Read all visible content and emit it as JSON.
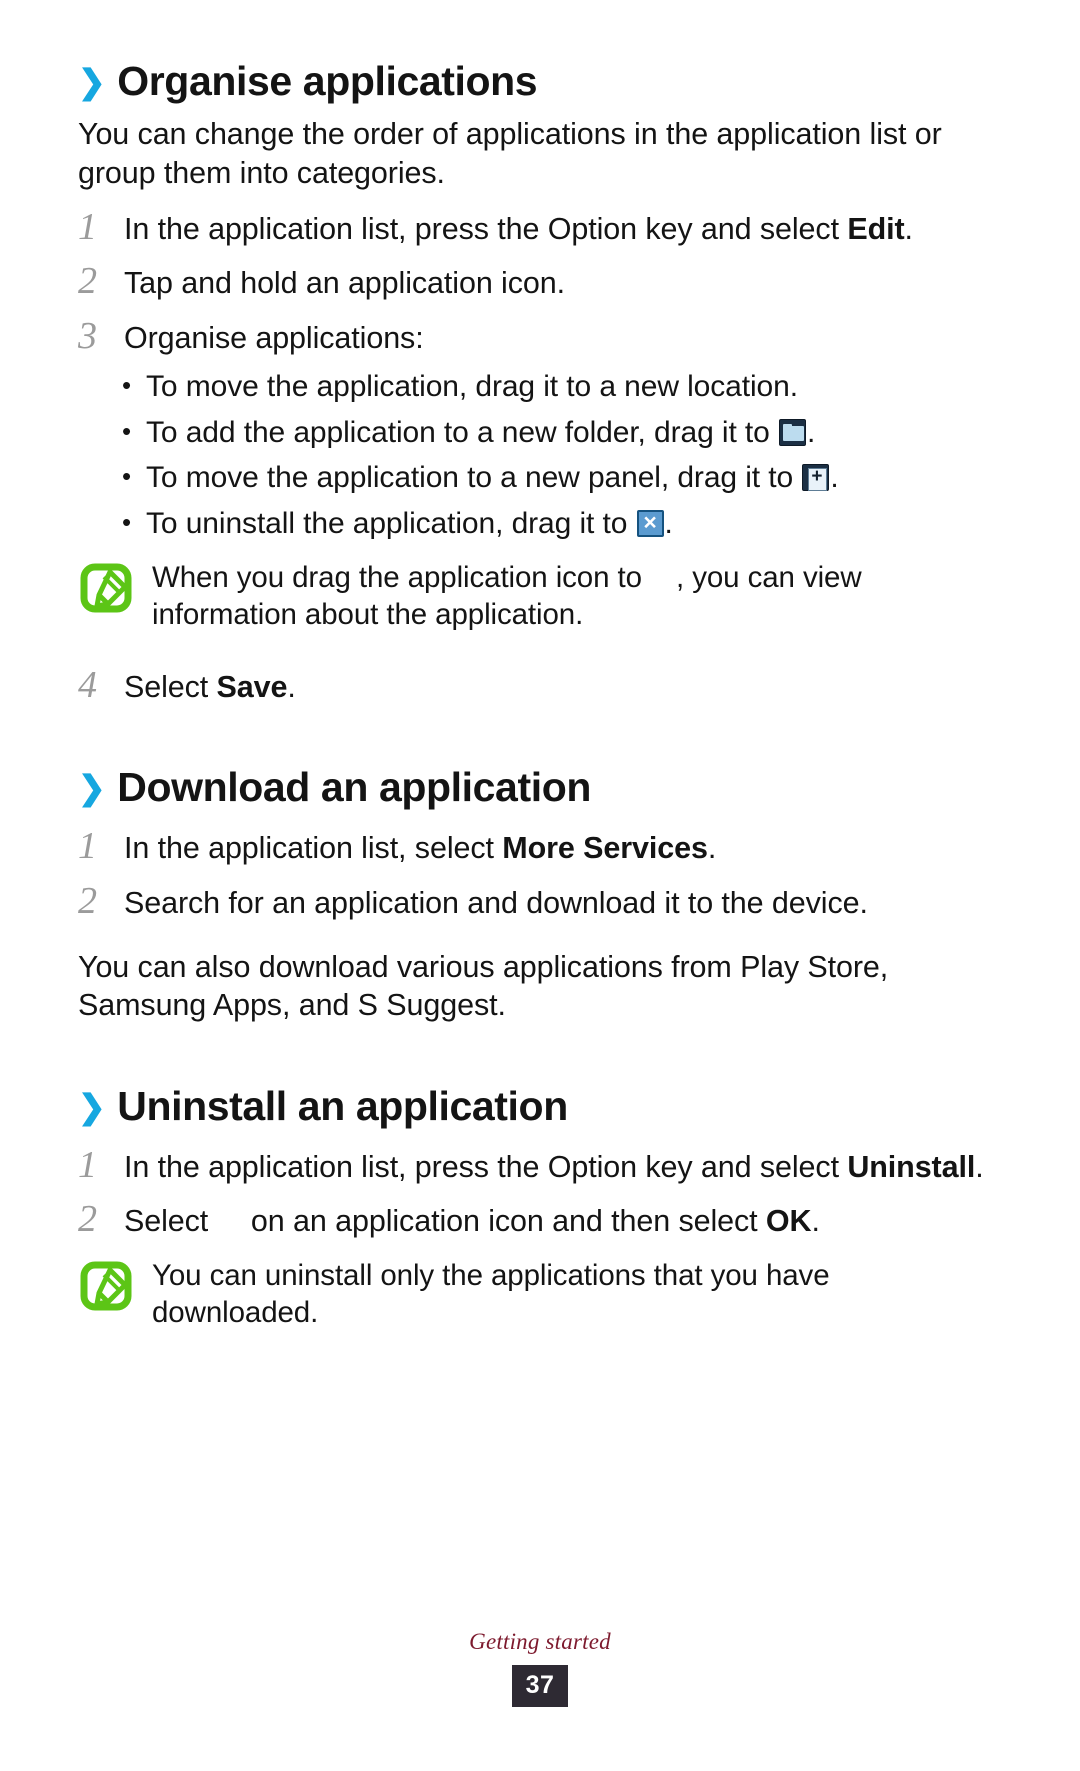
{
  "document": {
    "footer_label": "Getting started",
    "page_number": "37"
  },
  "colors": {
    "chevron": "#16a7e0",
    "step_number": "#9b9b9b",
    "note_icon": "#5cc516",
    "footer_label": "#7d1a2e",
    "page_badge_bg": "#2e2a33",
    "uninstall_icon": "#5b9bd0",
    "folder_icon_bg": "#1b2f44",
    "folder_icon_fill": "#bcdcef"
  },
  "sections": [
    {
      "id": "organise-applications",
      "chevron": "❯",
      "heading": "Organise applications",
      "intro": "You can change the order of applications in the application list or group them into categories.",
      "steps": [
        {
          "number": "1",
          "text_before": "In the application list, press the Option key and select ",
          "bold": "Edit",
          "text_after": "."
        },
        {
          "number": "2",
          "text_before": "Tap and hold an application icon.",
          "bold": "",
          "text_after": ""
        },
        {
          "number": "3",
          "text_before": "Organise applications:",
          "bold": "",
          "text_after": ""
        }
      ],
      "bullets": [
        {
          "dot": "•",
          "text_before": "To move the application, drag it to a new location.",
          "icon": "",
          "text_after": ""
        },
        {
          "dot": "•",
          "text_before": "To add the application to a new folder, drag it to ",
          "icon": "folder-icon",
          "text_after": "."
        },
        {
          "dot": "•",
          "text_before": "To move the application to a new panel, drag it to ",
          "icon": "new-panel-icon",
          "text_after": "."
        },
        {
          "dot": "•",
          "text_before": "To uninstall the application, drag it to ",
          "icon": "uninstall-icon",
          "text_after": "."
        }
      ],
      "note": {
        "icon": "note-pencil-icon",
        "text_before": "When you drag the application icon to ",
        "text_after": ", you can view information about the application."
      },
      "final_step": {
        "number": "4",
        "text_before": "Select ",
        "bold": "Save",
        "text_after": "."
      }
    },
    {
      "id": "download-an-application",
      "chevron": "❯",
      "heading": "Download an application",
      "steps": [
        {
          "number": "1",
          "text_before": "In the application list, select ",
          "bold": "More Services",
          "text_after": "."
        },
        {
          "number": "2",
          "text_before": "Search for an application and download it to the device.",
          "bold": "",
          "text_after": ""
        }
      ],
      "outro": "You can also download various applications from Play Store, Samsung Apps, and S Suggest."
    },
    {
      "id": "uninstall-an-application",
      "chevron": "❯",
      "heading": "Uninstall an application",
      "steps": [
        {
          "number": "1",
          "text_before": "In the application list, press the Option key and select ",
          "bold": "Uninstall",
          "text_after": "."
        },
        {
          "number": "2",
          "text_before": "Select ",
          "mid_icon": "minus-badge-icon",
          "text_mid": " on an application icon and then select ",
          "bold": "OK",
          "text_after": "."
        }
      ],
      "note": {
        "icon": "note-pencil-icon",
        "text": "You can uninstall only the applications that you have downloaded."
      }
    }
  ]
}
